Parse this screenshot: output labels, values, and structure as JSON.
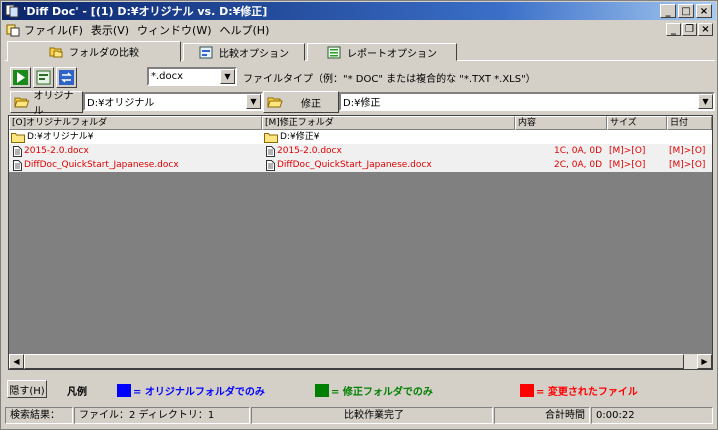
{
  "window": {
    "title": "'Diff Doc' - [(1) D:¥オリジナル vs. D:¥修正]"
  },
  "menu": {
    "items": [
      "ファイル(F)",
      "表示(V)",
      "ウィンドウ(W)",
      "ヘルプ(H)"
    ]
  },
  "tabs": [
    "フォルダの比較",
    "比較オプション",
    "レポートオプション"
  ],
  "toolbar": {
    "filter_value": "*.docx",
    "filetype_label": "ファイルタイプ（例：\"* DOC\" または複合的な \"*.TXT *.XLS\"）",
    "original_button": "オリジナル",
    "original_path": "D:¥オリジナル",
    "modified_button": "修正",
    "modified_path": "D:¥修正"
  },
  "list": {
    "columns": [
      "[O]オリジナルフォルダ",
      "[M]修正フォルダ",
      "内容",
      "サイズ",
      "日付"
    ],
    "rows": [
      {
        "orig": "D:¥オリジナル¥",
        "mod": "D:¥修正¥",
        "content": "",
        "size": "",
        "date": "",
        "folder": true
      },
      {
        "orig": "2015-2.0.docx",
        "mod": "2015-2.0.docx",
        "content": "1C, 0A, 0D",
        "size": "[M]>[O]",
        "date": "[M]>[O]",
        "folder": false
      },
      {
        "orig": "DiffDoc_QuickStart_Japanese.docx",
        "mod": "DiffDoc_QuickStart_Japanese.docx",
        "content": "2C, 0A, 0D",
        "size": "[M]>[O]",
        "date": "[M]>[O]",
        "folder": false
      }
    ]
  },
  "legend": {
    "hide_button": "隠す(H)",
    "title": "凡例",
    "items": [
      {
        "label": "= オリジナルフォルダでのみ",
        "color": "#0000ff"
      },
      {
        "label": "= 修正フォルダでのみ",
        "color": "#008000"
      },
      {
        "label": "= 変更されたファイル",
        "color": "#ff0000"
      }
    ]
  },
  "status": {
    "result_label": "検索結果：",
    "result_value": "ファイル：2  ディレクトリ：1",
    "message": "比較作業完了",
    "time_label": "合計時間",
    "time_value": "0:00:22"
  }
}
